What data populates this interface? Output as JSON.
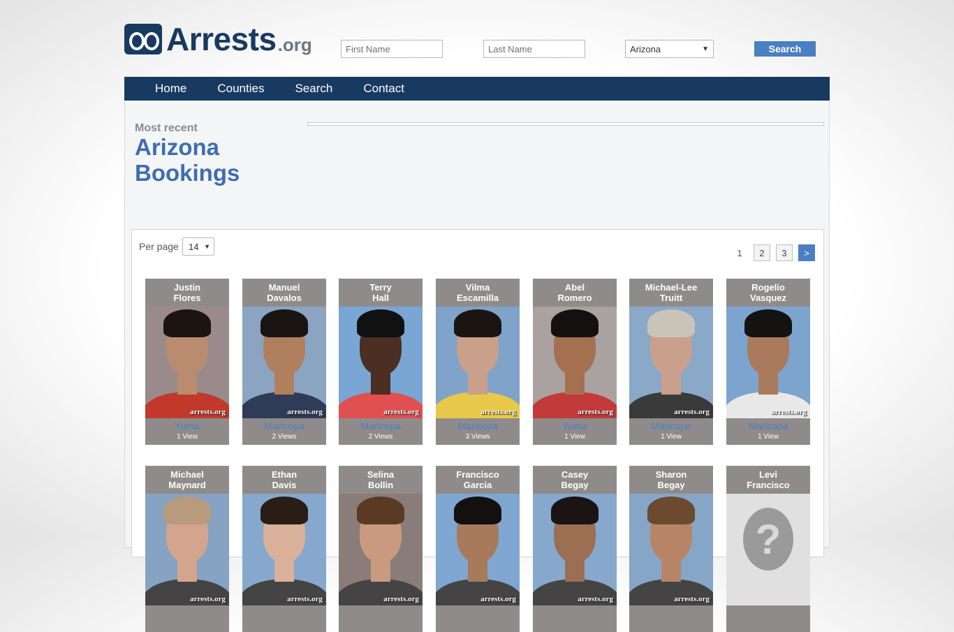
{
  "brand": {
    "name": "Arrests",
    "tld": ".org"
  },
  "search": {
    "first_name_placeholder": "First Name",
    "last_name_placeholder": "Last Name",
    "state_value": "Arizona",
    "button_label": "Search"
  },
  "nav": {
    "items": [
      "Home",
      "Counties",
      "Search",
      "Contact"
    ]
  },
  "heading": {
    "kicker": "Most recent",
    "title_line1": "Arizona",
    "title_line2": "Bookings"
  },
  "listing": {
    "per_page_label": "Per page",
    "per_page_value": "14",
    "pager": {
      "current": "1",
      "pages": [
        "2",
        "3"
      ],
      "next": ">"
    }
  },
  "records": [
    {
      "first": "Justin",
      "last": "Flores",
      "county": "Yuma",
      "views": "1 View",
      "photo": {
        "bg": "#9a8a8c",
        "skin": "#b98c6f",
        "hair": "#1c1410",
        "shirt": "#c0392b"
      }
    },
    {
      "first": "Manuel",
      "last": "Davalos",
      "county": "Maricopa",
      "views": "2 Views",
      "photo": {
        "bg": "#8aa4c2",
        "skin": "#b07f5e",
        "hair": "#1a1512",
        "shirt": "#2f3b57"
      }
    },
    {
      "first": "Terry",
      "last": "Hall",
      "county": "Maricopa",
      "views": "2 Views",
      "photo": {
        "bg": "#79a6d3",
        "skin": "#4a2f22",
        "hair": "#111",
        "shirt": "#e05050"
      }
    },
    {
      "first": "Vilma",
      "last": "Escamilla",
      "county": "Maricopa",
      "views": "3 Views",
      "photo": {
        "bg": "#7fa3c9",
        "skin": "#c9a08a",
        "hair": "#1b1512",
        "shirt": "#e8c84a"
      }
    },
    {
      "first": "Abel",
      "last": "Romero",
      "county": "Yuma",
      "views": "1 View",
      "photo": {
        "bg": "#a9a2a0",
        "skin": "#a5704f",
        "hair": "#141010",
        "shirt": "#c23a3a"
      }
    },
    {
      "first": "Michael-Lee",
      "last": "Truitt",
      "county": "Maricopa",
      "views": "1 View",
      "photo": {
        "bg": "#8aa8c8",
        "skin": "#c9a08c",
        "hair": "#c9c3b8",
        "shirt": "#3a3a3a"
      }
    },
    {
      "first": "Rogelio",
      "last": "Vasquez",
      "county": "Maricopa",
      "views": "1 View",
      "photo": {
        "bg": "#7da4cf",
        "skin": "#a97a5c",
        "hair": "#151212",
        "shirt": "#e8e8e8"
      }
    },
    {
      "first": "Michael",
      "last": "Maynard",
      "county": "",
      "views": "",
      "photo": {
        "bg": "#86a3c4",
        "skin": "#d4a48c",
        "hair": "#b89a7c",
        "shirt": "#444"
      }
    },
    {
      "first": "Ethan",
      "last": "Davis",
      "county": "",
      "views": "",
      "photo": {
        "bg": "#86a8cc",
        "skin": "#d9b09a",
        "hair": "#2a1d15",
        "shirt": "#444"
      }
    },
    {
      "first": "Selina",
      "last": "Bollin",
      "county": "",
      "views": "",
      "photo": {
        "bg": "#8a7c78",
        "skin": "#c99a80",
        "hair": "#5a3a24",
        "shirt": "#444"
      }
    },
    {
      "first": "Francisco",
      "last": "Garcia",
      "county": "",
      "views": "",
      "photo": {
        "bg": "#7fa6d0",
        "skin": "#a77a5c",
        "hair": "#141010",
        "shirt": "#444"
      }
    },
    {
      "first": "Casey",
      "last": "Begay",
      "county": "",
      "views": "",
      "photo": {
        "bg": "#86a8cc",
        "skin": "#9c6e52",
        "hair": "#1a1414",
        "shirt": "#444"
      }
    },
    {
      "first": "Sharon",
      "last": "Begay",
      "county": "",
      "views": "",
      "photo": {
        "bg": "#86a6c8",
        "skin": "#b88468",
        "hair": "#6b4a30",
        "shirt": "#444"
      }
    },
    {
      "first": "Levi",
      "last": "Francisco",
      "county": "",
      "views": "",
      "photo": {
        "bg": "#e0e0e0",
        "placeholder": true,
        "placeholder_glyph": "?"
      }
    }
  ],
  "watermark": "arrests.org"
}
